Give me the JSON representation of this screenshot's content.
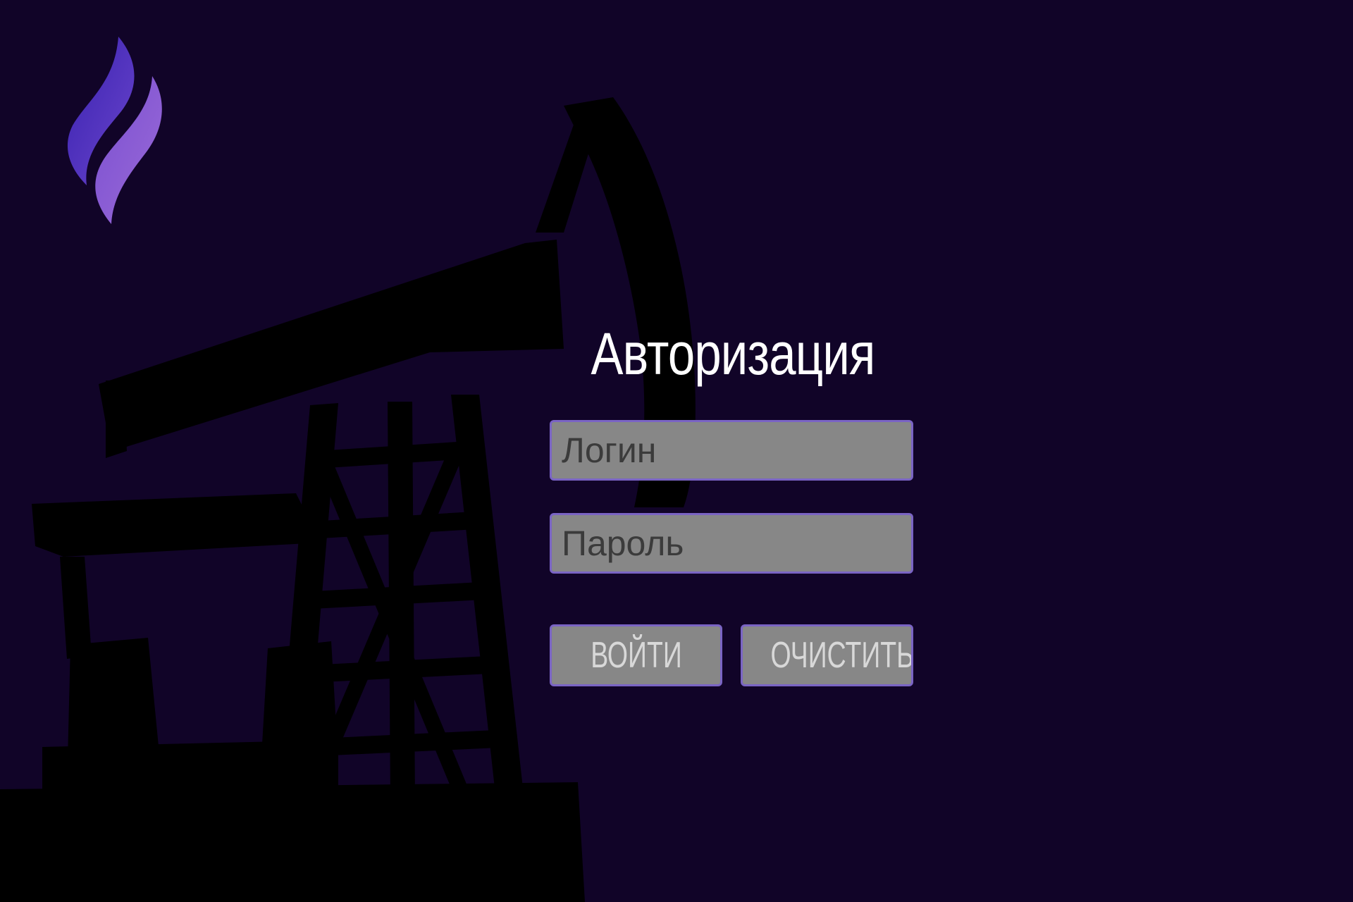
{
  "page": {
    "title": "Авторизация"
  },
  "form": {
    "login_placeholder": "Логин",
    "password_placeholder": "Пароль",
    "login_value": "",
    "password_value": ""
  },
  "buttons": {
    "submit_label": "ВОЙТИ",
    "clear_label": "ОЧИСТИТЬ"
  },
  "colors": {
    "background": "#110428",
    "silhouette": "#000000",
    "field_fill": "#878787",
    "field_border": "#7a64c4",
    "title_text": "#ffffff",
    "logo_top": "#4b2fbf",
    "logo_bottom": "#8e5bd0"
  },
  "icons": {
    "logo": "flame-logo-icon",
    "background": "oil-pump-jack-silhouette"
  }
}
